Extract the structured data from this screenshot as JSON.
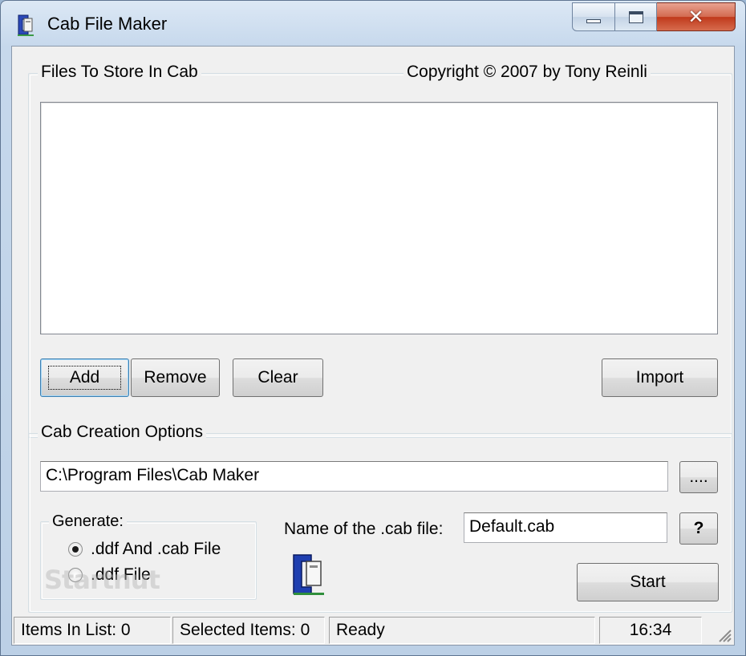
{
  "window": {
    "title": "Cab File Maker",
    "close_glyph": "✕"
  },
  "files_group": {
    "legend": "Files To Store In Cab",
    "copyright": "Copyright © 2007 by Tony Reinli",
    "items": []
  },
  "buttons": {
    "add": "Add",
    "remove": "Remove",
    "clear": "Clear",
    "import": "Import",
    "browse": "....",
    "help": "?",
    "start": "Start"
  },
  "options_group": {
    "legend": "Cab Creation Options",
    "path_value": "C:\\Program Files\\Cab Maker",
    "generate_legend": "Generate:",
    "radio_ddf_cab": ".ddf And .cab File",
    "radio_ddf": ".ddf File",
    "radio_selected": "ddf_cab",
    "cab_name_label": "Name of the .cab file:",
    "cab_name_value": "Default.cab"
  },
  "status": {
    "items_in_list": "Items In List: 0",
    "selected_items": "Selected Items: 0",
    "state": "Ready",
    "time": "16:34"
  },
  "watermark": "Startnut",
  "colors": {
    "accent_blue": "#1f3fb0",
    "titlebar": "#c6d8ec",
    "close_red": "#c0391c"
  },
  "icons": {
    "app": "cab-clamp-icon",
    "options": "cab-clamp-icon"
  }
}
